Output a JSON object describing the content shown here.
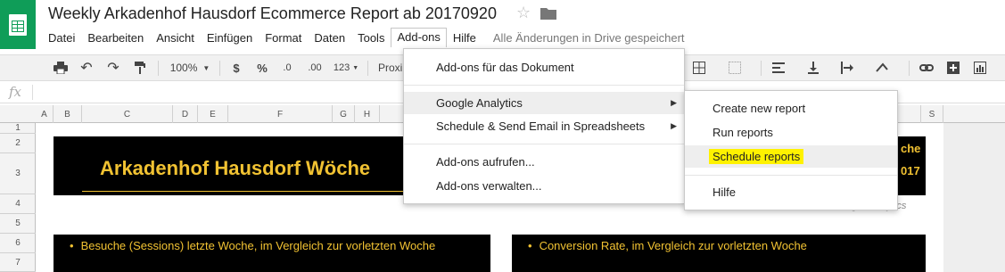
{
  "doc": {
    "title": "Weekly Arkadenhof Hausdorf Ecommerce Report ab 20170920"
  },
  "menubar": {
    "items": [
      "Datei",
      "Bearbeiten",
      "Ansicht",
      "Einfügen",
      "Format",
      "Daten",
      "Tools",
      "Add-ons",
      "Hilfe"
    ],
    "status": "Alle Änderungen in Drive gespeichert"
  },
  "toolbar": {
    "zoom": "100%",
    "currency": "$",
    "percent": "%",
    "dec_decrease": ".0",
    "dec_increase": ".00",
    "more_formats": "123",
    "font": "Proxi"
  },
  "formula_bar": {
    "fx": "fx"
  },
  "grid": {
    "columns": [
      "A",
      "B",
      "C",
      "D",
      "E",
      "F",
      "G",
      "H",
      "S"
    ],
    "rows": [
      "1",
      "2",
      "3",
      "4",
      "5",
      "6",
      "7"
    ]
  },
  "sheet": {
    "banner_title": "Arkadenhof Hausdorf Wöche",
    "banner_right_1": "che",
    "banner_right_2": "017",
    "analytics_note": "gle Analytics",
    "box_left_text": "Besuche (Sessions) letzte Woche, im Vergleich zur vorletzten Woche",
    "box_right_text": "Conversion Rate, im Vergleich zur vorletzten Woche"
  },
  "addons_menu": {
    "items": [
      {
        "label": "Add-ons für das Dokument"
      },
      {
        "label": "Google Analytics",
        "has_submenu": true
      },
      {
        "label": "Schedule & Send Email in Spreadsheets",
        "has_submenu": true
      },
      {
        "label": "Add-ons aufrufen..."
      },
      {
        "label": "Add-ons verwalten..."
      }
    ]
  },
  "ga_submenu": {
    "items": [
      {
        "label": "Create new report"
      },
      {
        "label": "Run reports"
      },
      {
        "label": "Schedule reports"
      },
      {
        "label": "Hilfe"
      }
    ]
  },
  "colors": {
    "sheets_green": "#0f9d58",
    "banner_bg": "#000000",
    "banner_text": "#f1c232",
    "highlight": "#fff200"
  }
}
